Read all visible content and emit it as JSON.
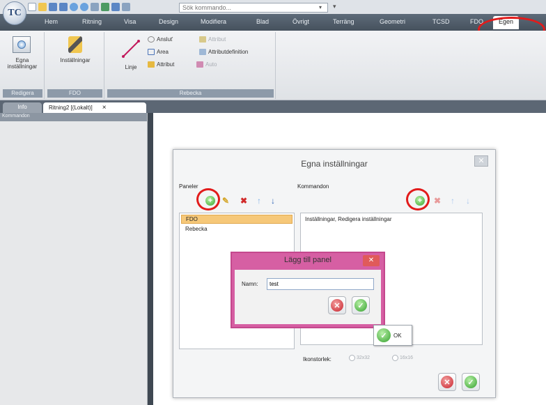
{
  "app": {
    "logo_text": "TC"
  },
  "qat": {
    "search_placeholder": "Sök kommando..."
  },
  "menu_tabs": [
    "Hem",
    "Ritning",
    "Visa",
    "Design",
    "Modifiera",
    "Blad",
    "Övrigt",
    "Terräng",
    "Geometri",
    "TCSD",
    "FDO",
    "Egen"
  ],
  "active_tab": "Egen",
  "ribbon": {
    "groups": [
      {
        "name": "Redigera",
        "buttons": [
          {
            "label": "Egna inställningar"
          }
        ]
      },
      {
        "name": "FDO",
        "buttons": [
          {
            "label": "Inställningar"
          }
        ]
      },
      {
        "name": "Rebecka",
        "large": {
          "label": "Linje"
        },
        "small": [
          {
            "label": "Ansluť",
            "enabled": true
          },
          {
            "label": "Attribut",
            "enabled": false
          },
          {
            "label": "Area",
            "enabled": true
          },
          {
            "label": "Attributdefinition",
            "enabled": true
          },
          {
            "label": "Attribut",
            "enabled": true
          },
          {
            "label": "Auto",
            "enabled": false
          }
        ]
      }
    ]
  },
  "doc_tabs": [
    {
      "label": "Info"
    },
    {
      "label": "Ritning2 [(Lokalt)]",
      "active": true,
      "close": "×"
    }
  ],
  "left_panel": {
    "header": "Kommandon"
  },
  "dialog": {
    "title": "Egna inställningar",
    "close": "✕",
    "panels_label": "Paneler",
    "commands_label": "Kommandon",
    "panels": [
      "FDO",
      "Rebecka"
    ],
    "selected_panel": "FDO",
    "commands": [
      "Inställningar, Redigera inställningar"
    ],
    "icon_size_label": "Ikonstorlek:",
    "icon_sizes": [
      "32x32",
      "16x16"
    ]
  },
  "popup": {
    "title": "Lägg till panel",
    "close": "✕",
    "name_label": "Namn:",
    "name_value": "test"
  },
  "tooltip": {
    "text": "OK"
  },
  "colors": {
    "annotation_ring": "#e21b1b",
    "popup_border": "#d65fa3",
    "selection": "#f6c879"
  }
}
